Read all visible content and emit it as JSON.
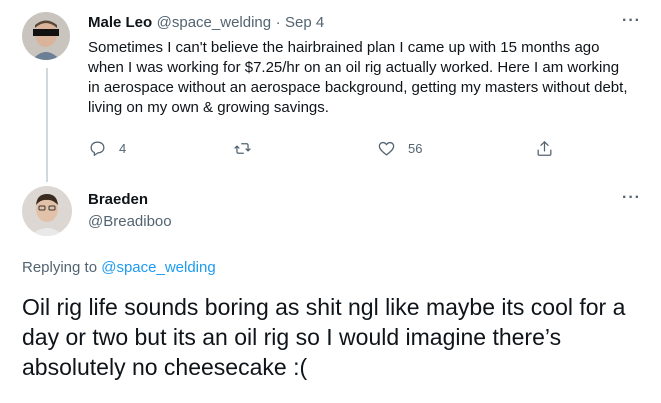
{
  "tweet": {
    "author_name": "Male Leo",
    "author_handle": "@space_welding",
    "separator": "·",
    "date": "Sep 4",
    "text": "Sometimes I can't believe the hairbrained plan I came up with 15 months ago when I was working for $7.25/hr on an oil rig actually worked. Here I am working in aerospace without an aerospace background, getting my masters without debt, living on my own & growing savings.",
    "reply_count": "4",
    "like_count": "56",
    "more": "···"
  },
  "reply": {
    "author_name": "Braeden",
    "author_handle": "@Breadiboo",
    "replying_prefix": "Replying to",
    "replying_handle": "@space_welding",
    "text": "Oil rig life sounds boring as shit ngl like maybe its cool for a day or two but its an oil rig so I would imagine there’s absolutely no cheesecake :(",
    "more": "···"
  },
  "colors": {
    "accent": "#1d9bf0",
    "secondary_text": "#536471",
    "thread_line": "#cfd9de"
  }
}
